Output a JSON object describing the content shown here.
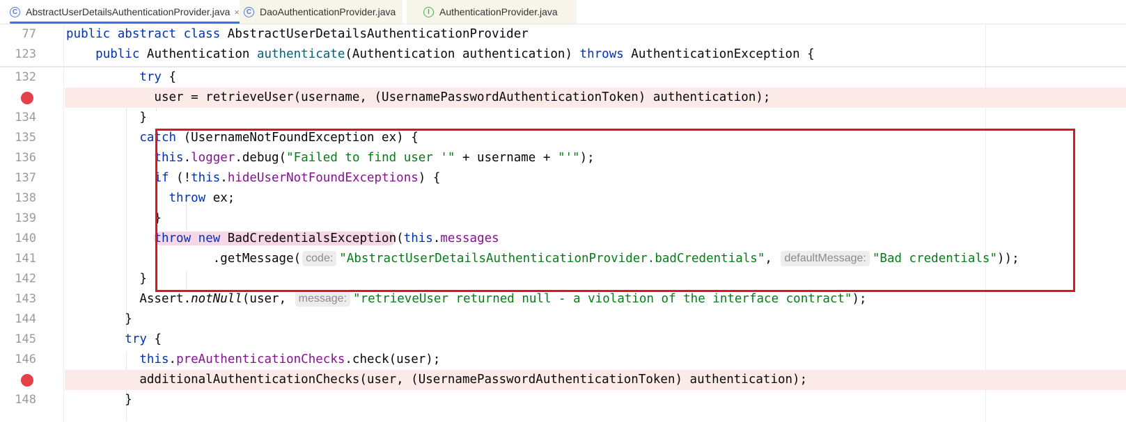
{
  "tabs": [
    {
      "label": "AbstractUserDetailsAuthenticationProvider.java",
      "icon": "class-icon",
      "icon_glyph": "C",
      "active": true,
      "close": "×"
    },
    {
      "label": "DaoAuthenticationProvider.java",
      "icon": "class-icon",
      "icon_glyph": "C",
      "active": false
    },
    {
      "label": "AuthenticationProvider.java",
      "icon": "interface-icon",
      "icon_glyph": "I",
      "active": false
    }
  ],
  "sticky": [
    {
      "num": "77"
    },
    {
      "num": "123"
    }
  ],
  "lines": [
    {
      "num": "132"
    },
    {
      "num": "",
      "breakpoint": true
    },
    {
      "num": "134"
    },
    {
      "num": "135"
    },
    {
      "num": "136"
    },
    {
      "num": "137"
    },
    {
      "num": "138"
    },
    {
      "num": "139"
    },
    {
      "num": "140"
    },
    {
      "num": "141"
    },
    {
      "num": "142"
    },
    {
      "num": "143"
    },
    {
      "num": "144"
    },
    {
      "num": "145"
    },
    {
      "num": "146"
    },
    {
      "num": "",
      "breakpoint": true
    },
    {
      "num": "148"
    }
  ],
  "hints": {
    "code": "code:",
    "defaultMessage": "defaultMessage:",
    "message": "message:"
  },
  "colors": {
    "keyword": "#0033b3",
    "method": "#00627a",
    "field": "#871094",
    "string": "#067d17",
    "breakpoint": "#e5404a",
    "highlight_box": "#e0141f"
  }
}
